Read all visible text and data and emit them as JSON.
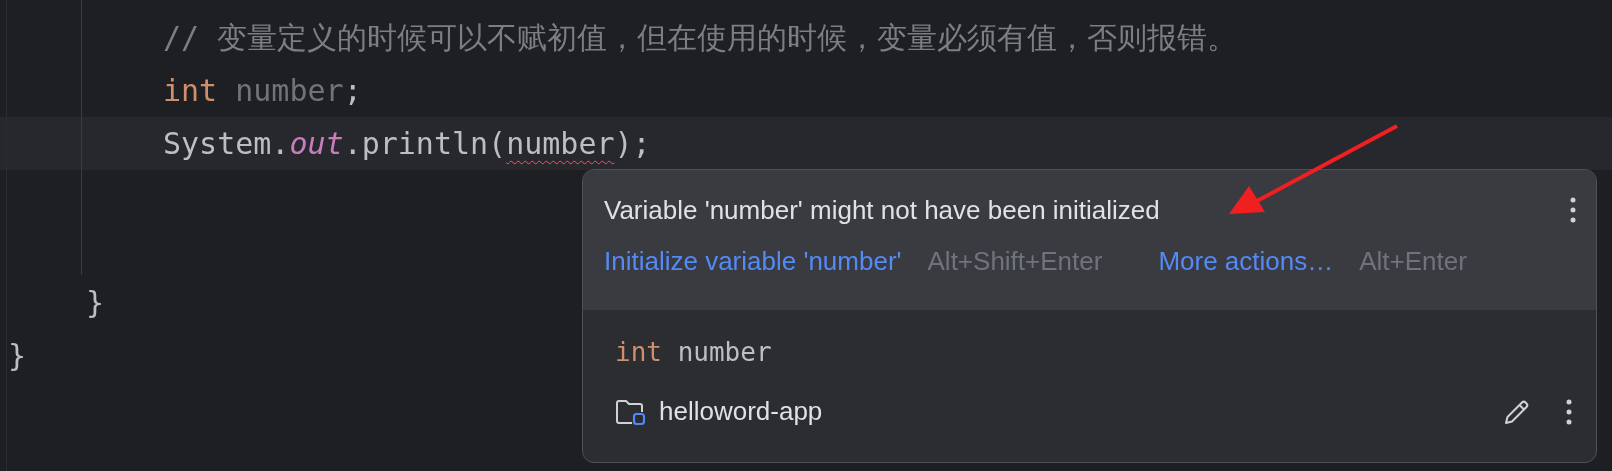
{
  "code_lines": [
    {
      "kind": "statement",
      "current": false,
      "tokens": [
        {
          "kind": "comment",
          "text": "// 变量定义的时候可以不赋初值，但在使用的时候，变量必须有值，否则报错。"
        }
      ]
    },
    {
      "kind": "statement",
      "current": false,
      "tokens": [
        {
          "kind": "keyword",
          "text": "int "
        },
        {
          "kind": "unused",
          "text": "number"
        },
        {
          "kind": "plain",
          "text": ";"
        }
      ]
    },
    {
      "kind": "statement",
      "current": true,
      "tokens": [
        {
          "kind": "plain",
          "text": "System."
        },
        {
          "kind": "static",
          "text": "out"
        },
        {
          "kind": "plain",
          "text": ".println("
        },
        {
          "kind": "error",
          "text": "number"
        },
        {
          "kind": "plain",
          "text": ");"
        }
      ]
    },
    {
      "kind": "method_close",
      "current": false,
      "tokens": [
        {
          "kind": "plain",
          "text": "}"
        }
      ]
    },
    {
      "kind": "class_close",
      "current": false,
      "tokens": [
        {
          "kind": "plain",
          "text": "}"
        }
      ]
    }
  ],
  "popup": {
    "message": "Variable 'number' might not have been initialized",
    "actions": [
      {
        "label": "Initialize variable 'number'",
        "shortcut": "Alt+Shift+Enter"
      },
      {
        "label": "More actions…",
        "shortcut": "Alt+Enter"
      }
    ],
    "declaration": [
      {
        "kind": "keyword",
        "text": "int "
      },
      {
        "kind": "plain",
        "text": "number"
      }
    ],
    "module": "helloword-app"
  }
}
